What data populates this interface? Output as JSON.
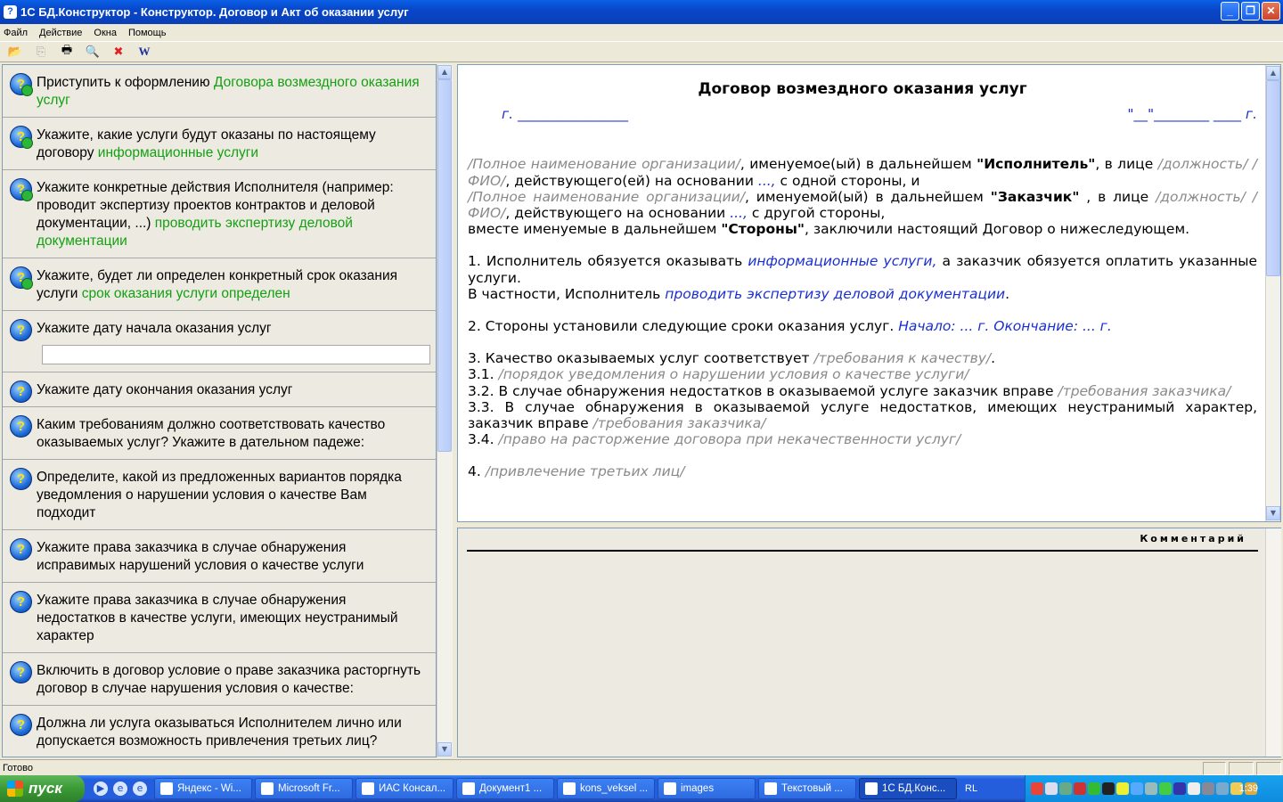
{
  "window": {
    "title": "1С БД.Конструктор - Конструктор. Договор и Акт об оказании услуг",
    "icon": "app-icon",
    "buttons": [
      "minimize-icon",
      "restore-icon",
      "close-icon"
    ]
  },
  "menu": [
    "Файл",
    "Действие",
    "Окна",
    "Помощь"
  ],
  "toolbar": [
    "open-folder-icon",
    "copy-icon",
    "print-icon",
    "preview-icon",
    "delete-icon",
    "word-icon"
  ],
  "questions": [
    {
      "text": "Приступить к оформлению",
      "answer": "Договора возмездного оказания услуг",
      "done": true
    },
    {
      "text": "Укажите, какие услуги будут оказаны по настоящему договору",
      "answer": "информационные услуги",
      "done": true
    },
    {
      "text": "Укажите конкретные действия Исполнителя (например: проводит экспертизу проектов контрактов и деловой документации, ...)",
      "answer": "проводить экспертизу деловой документации",
      "done": true
    },
    {
      "text": "Укажите, будет ли определен конкретный срок оказания услуги",
      "answer": "срок оказания услуги определен",
      "done": true
    },
    {
      "text": "Укажите дату начала оказания услуг",
      "answer": "",
      "input_value": "",
      "done": false
    },
    {
      "text": "Укажите дату окончания оказания услуг",
      "answer": "",
      "done": false
    },
    {
      "text": "Каким требованиям должно соответствовать качество оказываемых услуг? Укажите в дательном падеже:",
      "answer": "",
      "done": false
    },
    {
      "text": "Определите, какой из предложенных вариантов порядка уведомления о нарушении условия о качестве Вам подходит",
      "answer": "",
      "done": false
    },
    {
      "text": "Укажите права заказчика в случае обнаружения исправимых нарушений условия о качестве услуги",
      "answer": "",
      "done": false
    },
    {
      "text": "Укажите права заказчика в случае обнаружения недостатков в качестве услуги, имеющих неустранимый характер",
      "answer": "",
      "done": false
    },
    {
      "text": "Включить в договор условие о праве заказчика расторгнуть договор в случае нарушения условия о качестве:",
      "answer": "",
      "done": false
    },
    {
      "text": "Должна ли услуга оказываться Исполнителем лично или допускается возможность привлечения третьих лиц?",
      "answer": "",
      "done": false
    }
  ],
  "doc": {
    "title": "Договор возмездного оказания услуг",
    "city": "г. ________________",
    "date": "\"__\"________ ____ г.",
    "p1": {
      "a": "/Полное наименование организации/",
      "b": ", именуемое(ый) в дальнейшем ",
      "c": "\"Исполнитель\"",
      "d": ", в лице ",
      "e": "/должность/ /ФИО/",
      "f": ", действующего(ей) на основании ",
      "g": "...,",
      "h": " с одной стороны, и"
    },
    "p2": {
      "a": "/Полное наименование организации/",
      "b": ", именуемой(ый) в дальнейшем ",
      "c": "\"Заказчик\"",
      "d": " , в лице ",
      "e": "/должность/ /ФИО/",
      "f": ", действующего на основании ",
      "g": "...,",
      "h": " с другой стороны,"
    },
    "p3": {
      "a": "вместе именуемые в дальнейшем ",
      "b": "\"Стороны\"",
      "c": ", заключили настоящий Договор о нижеследующем."
    },
    "s1": {
      "a": "1. Исполнитель обязуется оказывать ",
      "b": "информационные услуги,",
      "c": " а заказчик обязуется оплатить указанные услуги."
    },
    "s1b": {
      "a": "В частности, Исполнитель ",
      "b": "проводить экспертизу деловой документации",
      "c": "."
    },
    "s2": {
      "a": "2. Стороны установили следующие сроки оказания услуг. ",
      "b": "Начало: ... г. Окончание: ... г."
    },
    "s3": {
      "a": "3. Качество оказываемых услуг соответствует ",
      "b": "/требования к качеству/",
      "c": "."
    },
    "s31": {
      "a": "3.1. ",
      "b": "/порядок уведомления о нарушении условия о качестве услуги/"
    },
    "s32": {
      "a": "3.2. В случае обнаружения недостатков в оказываемой услуге заказчик вправе ",
      "b": "/требования заказчика/"
    },
    "s33": {
      "a": "3.3. В случае обнаружения в оказываемой услуге недостатков, имеющих неустранимый характер, заказчик вправе ",
      "b": "/требования заказчика/"
    },
    "s34": {
      "a": "3.4. ",
      "b": "/право на расторжение договора при некачественности услуг/"
    },
    "s4": {
      "a": "4. ",
      "b": "/привлечение третьих лиц/"
    }
  },
  "comment": {
    "title": "Комментарий"
  },
  "status": {
    "text": "Готово"
  },
  "taskbar": {
    "start": "пуск",
    "tasks": [
      "Яндекс - Wi...",
      "Microsoft Fr...",
      "ИАС Консал...",
      "Документ1 ...",
      "kons_veksel ...",
      "images",
      "Текстовый ...",
      "1С БД.Конс..."
    ],
    "active_task": 7,
    "lang": "RL",
    "clock": "1:39"
  },
  "colors": {
    "answer": "#14A012",
    "doc_field": "#1A2FD0",
    "placeholder": "#8A8A8A",
    "title_bar": "#0A5FE6"
  }
}
